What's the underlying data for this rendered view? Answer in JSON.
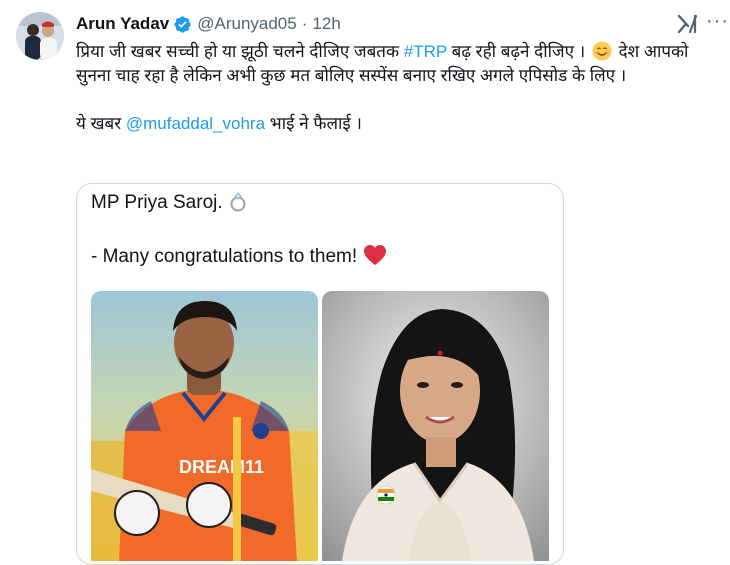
{
  "author": {
    "name": "Arun Yadav",
    "handle": "@Arunyad05",
    "separator": "·",
    "time": "12h"
  },
  "icons": {
    "verified": "verified-badge-icon",
    "grok": "grok-icon",
    "more": "more-options-icon"
  },
  "colors": {
    "link": "#1d9bf0",
    "verified": "#1d9bf0",
    "secondary_text": "#536471",
    "border": "#cfd9de"
  },
  "tweet": {
    "p1_a": "प्रिया जी खबर सच्ची हो या झूठी चलने दीजिए जबतक ",
    "p1_hashtag": "#TRP",
    "p1_b": " बढ़ रही बढ़ने दीजिए । ",
    "p1_c": " देश आपको सुनना चाह रहा है लेकिन अभी कुछ मत बोलिए सस्पेंस बनाए रखिए अगले एपिसोड के लिए ।",
    "p2_a": "ये खबर ",
    "p2_mention": "@mufaddal_vohra",
    "p2_b": " भाई ने फैलाई ।"
  },
  "quote": {
    "line1": "MP Priya Saroj.",
    "line2": "- Many congratulations to them!",
    "jersey_text": "DREAM11"
  }
}
